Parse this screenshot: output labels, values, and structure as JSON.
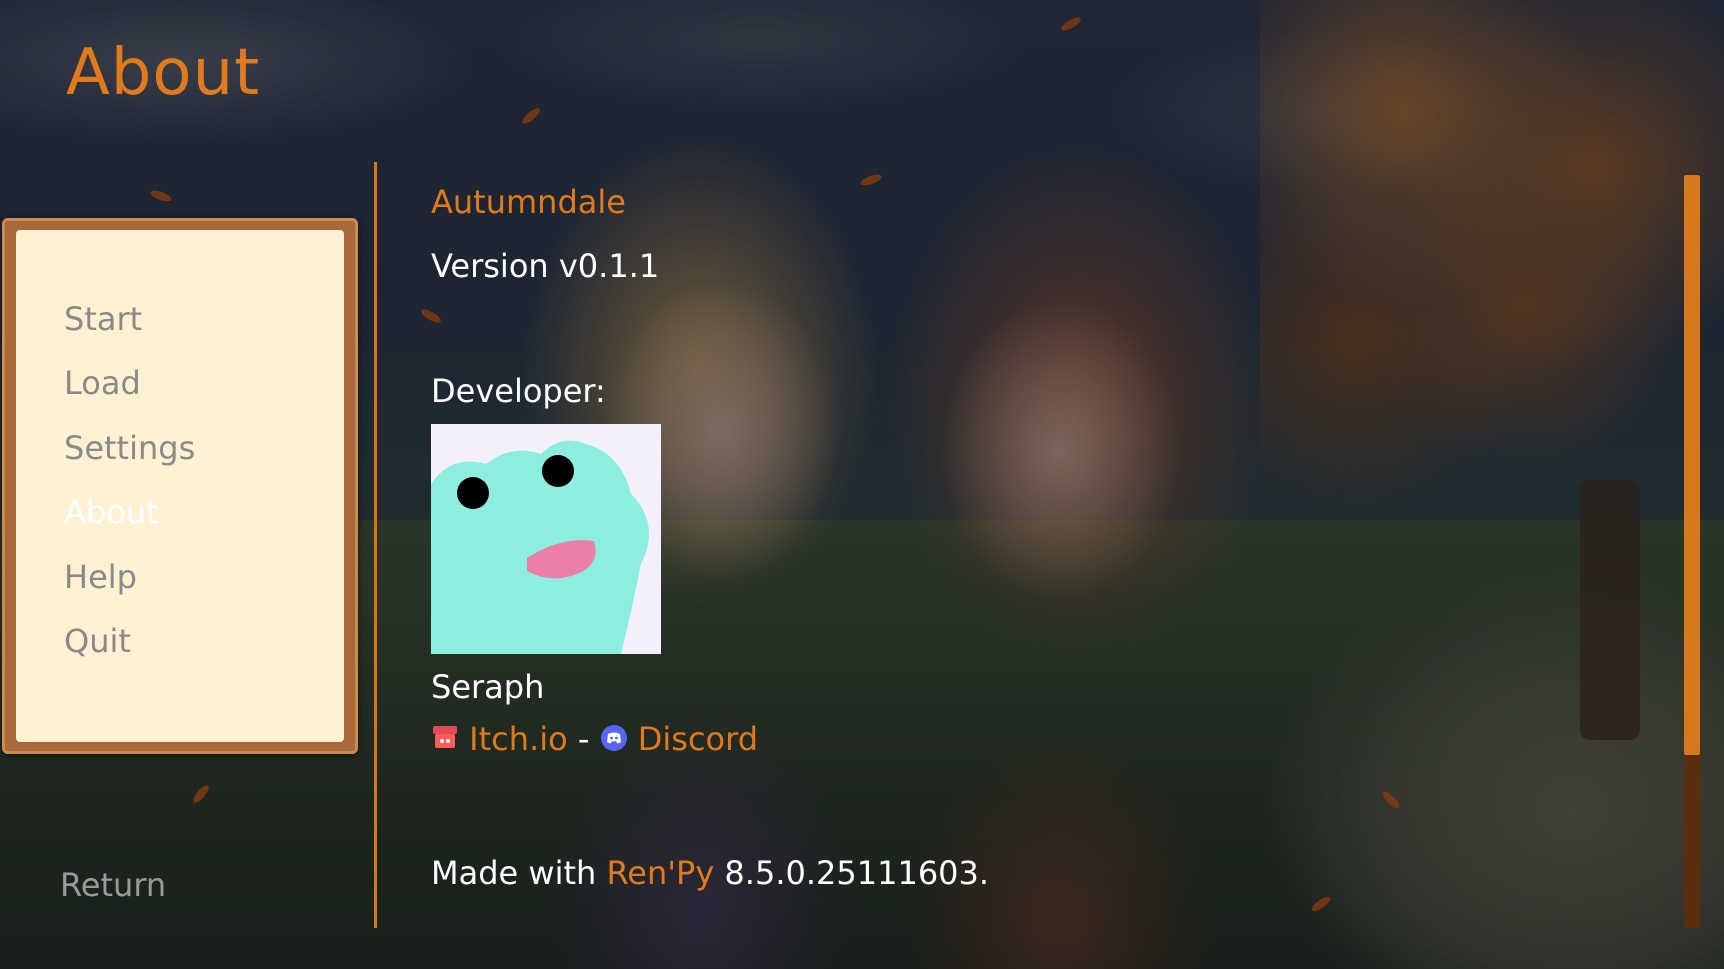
{
  "screen": {
    "title": "About"
  },
  "menu": {
    "items": [
      {
        "label": "Start",
        "active": false
      },
      {
        "label": "Load",
        "active": false
      },
      {
        "label": "Settings",
        "active": false
      },
      {
        "label": "About",
        "active": true
      },
      {
        "label": "Help",
        "active": false
      },
      {
        "label": "Quit",
        "active": false
      }
    ],
    "return_label": "Return"
  },
  "about": {
    "game_name": "Autumndale",
    "version": "Version v0.1.1",
    "developer_label": "Developer:",
    "developer_name": "Seraph",
    "links": {
      "itch_label": "Itch.io",
      "separator": "-",
      "discord_label": "Discord"
    },
    "made_with": {
      "prefix": "Made with",
      "engine": "Ren'Py",
      "suffix": "8.5.0.25111603."
    }
  },
  "scrollbar": {
    "position": 0,
    "visible_fraction": 0.77
  },
  "colors": {
    "accent": "#e07a1c",
    "menu_paper": "#fff2d3",
    "menu_frame": "#a8683a",
    "inactive_text": "#8a8a8a",
    "active_text": "#ffffff",
    "avatar_frog": "#8deee0",
    "avatar_bg": "#f3effb"
  },
  "icons": {
    "itch": "itchio-store-icon",
    "discord": "discord-icon",
    "avatar": "frog-avatar"
  }
}
